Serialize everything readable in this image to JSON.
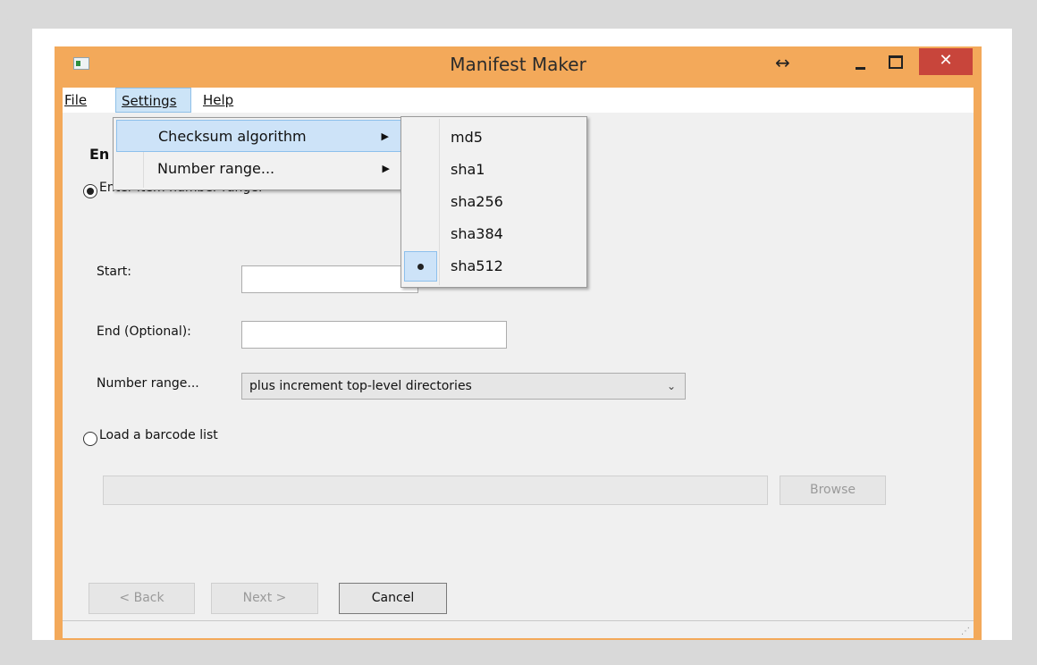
{
  "window": {
    "title": "Manifest Maker",
    "resize_glyph": "↔",
    "close_glyph": "✕"
  },
  "menubar": {
    "file": "File",
    "settings": "Settings",
    "help": "Help"
  },
  "settings_menu": {
    "items": [
      {
        "label": "Checksum algorithm",
        "has_submenu": true,
        "highlighted": true
      },
      {
        "label": "Number range...",
        "has_submenu": true,
        "highlighted": false
      }
    ],
    "submenu_arrow": "▶"
  },
  "checksum_menu": {
    "items": [
      "md5",
      "sha1",
      "sha256",
      "sha384",
      "sha512"
    ],
    "selected": "sha512"
  },
  "form": {
    "heading_fragment": "En",
    "enter_range_label": "Enter item number range:",
    "start_label": "Start:",
    "start_value": "",
    "end_label": "End (Optional):",
    "end_value": "",
    "number_range_label": "Number range...",
    "number_range_value": "plus increment top-level directories",
    "load_barcode_label": "Load a barcode list",
    "barcode_path": "",
    "browse_label": "Browse"
  },
  "buttons": {
    "back": "< Back",
    "next": "Next >",
    "cancel": "Cancel"
  },
  "colors": {
    "titlebar": "#f3a95a",
    "close": "#c8453b",
    "menu_highlight": "#cde3f8"
  }
}
